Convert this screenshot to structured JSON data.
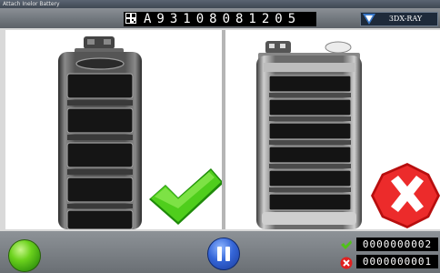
{
  "window": {
    "title": "Attach Inelor Battery"
  },
  "header": {
    "serial": "A93108081205",
    "logo_text": "3DX-RAY"
  },
  "inspection": {
    "left_result": "pass",
    "right_result": "fail"
  },
  "footer": {
    "status_light_color": "#5cc41a",
    "pause_icon": "pause-icon",
    "pass_count": "0000000002",
    "fail_count": "0000000001"
  }
}
